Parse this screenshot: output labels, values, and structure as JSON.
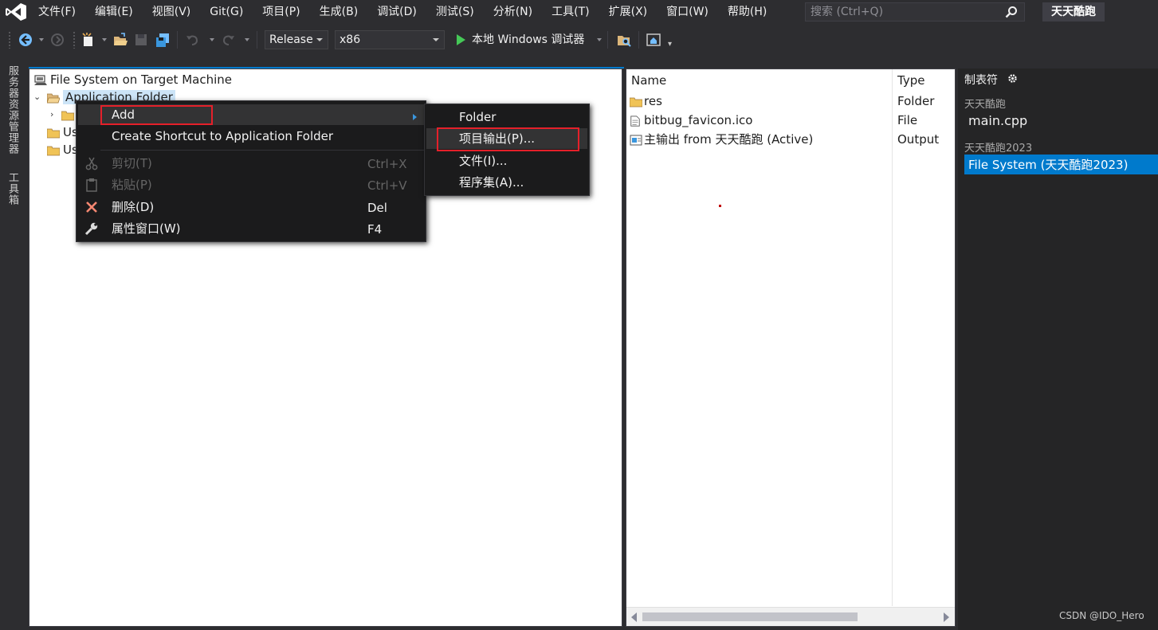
{
  "menubar": {
    "items": [
      "文件(F)",
      "编辑(E)",
      "视图(V)",
      "Git(G)",
      "项目(P)",
      "生成(B)",
      "调试(D)",
      "测试(S)",
      "分析(N)",
      "工具(T)",
      "扩展(X)",
      "窗口(W)",
      "帮助(H)"
    ],
    "search_placeholder": "搜索 (Ctrl+Q)",
    "solution_title": "天天酷跑"
  },
  "toolbar": {
    "configuration": "Release",
    "platform": "x86",
    "run_label": "本地 Windows 调试器"
  },
  "left_tabs": [
    "服务器资源管理器",
    "工具箱"
  ],
  "tree": {
    "root": "File System on Target Machine",
    "app_folder": "Application Folder",
    "user_folder_1": "Us",
    "user_folder_2": "Us"
  },
  "list": {
    "col_name": "Name",
    "col_type": "Type",
    "rows": [
      {
        "name": "res",
        "type": "Folder"
      },
      {
        "name": "bitbug_favicon.ico",
        "type": "File"
      },
      {
        "name": "主输出 from 天天酷跑 (Active)",
        "type": "Output"
      }
    ]
  },
  "explorer": {
    "title": "制表符",
    "group1": "天天酷跑",
    "item1": "main.cpp",
    "group2": "天天酷跑2023",
    "item2": "File System (天天酷跑2023)"
  },
  "context_menu": {
    "add": "Add",
    "create_shortcut": "Create Shortcut to Application Folder",
    "cut": "剪切(T)",
    "cut_key": "Ctrl+X",
    "paste": "粘贴(P)",
    "paste_key": "Ctrl+V",
    "delete": "删除(D)",
    "delete_key": "Del",
    "properties": "属性窗口(W)",
    "properties_key": "F4"
  },
  "submenu": {
    "folder": "Folder",
    "project_output": "项目输出(P)...",
    "file": "文件(I)...",
    "assembly": "程序集(A)..."
  },
  "watermark": "CSDN @IDO_Hero",
  "colors": {
    "accent": "#007acc",
    "highlight_border": "#e5202a",
    "chrome_bg": "#2d2d30",
    "menu_bg": "#1b1b1c"
  }
}
